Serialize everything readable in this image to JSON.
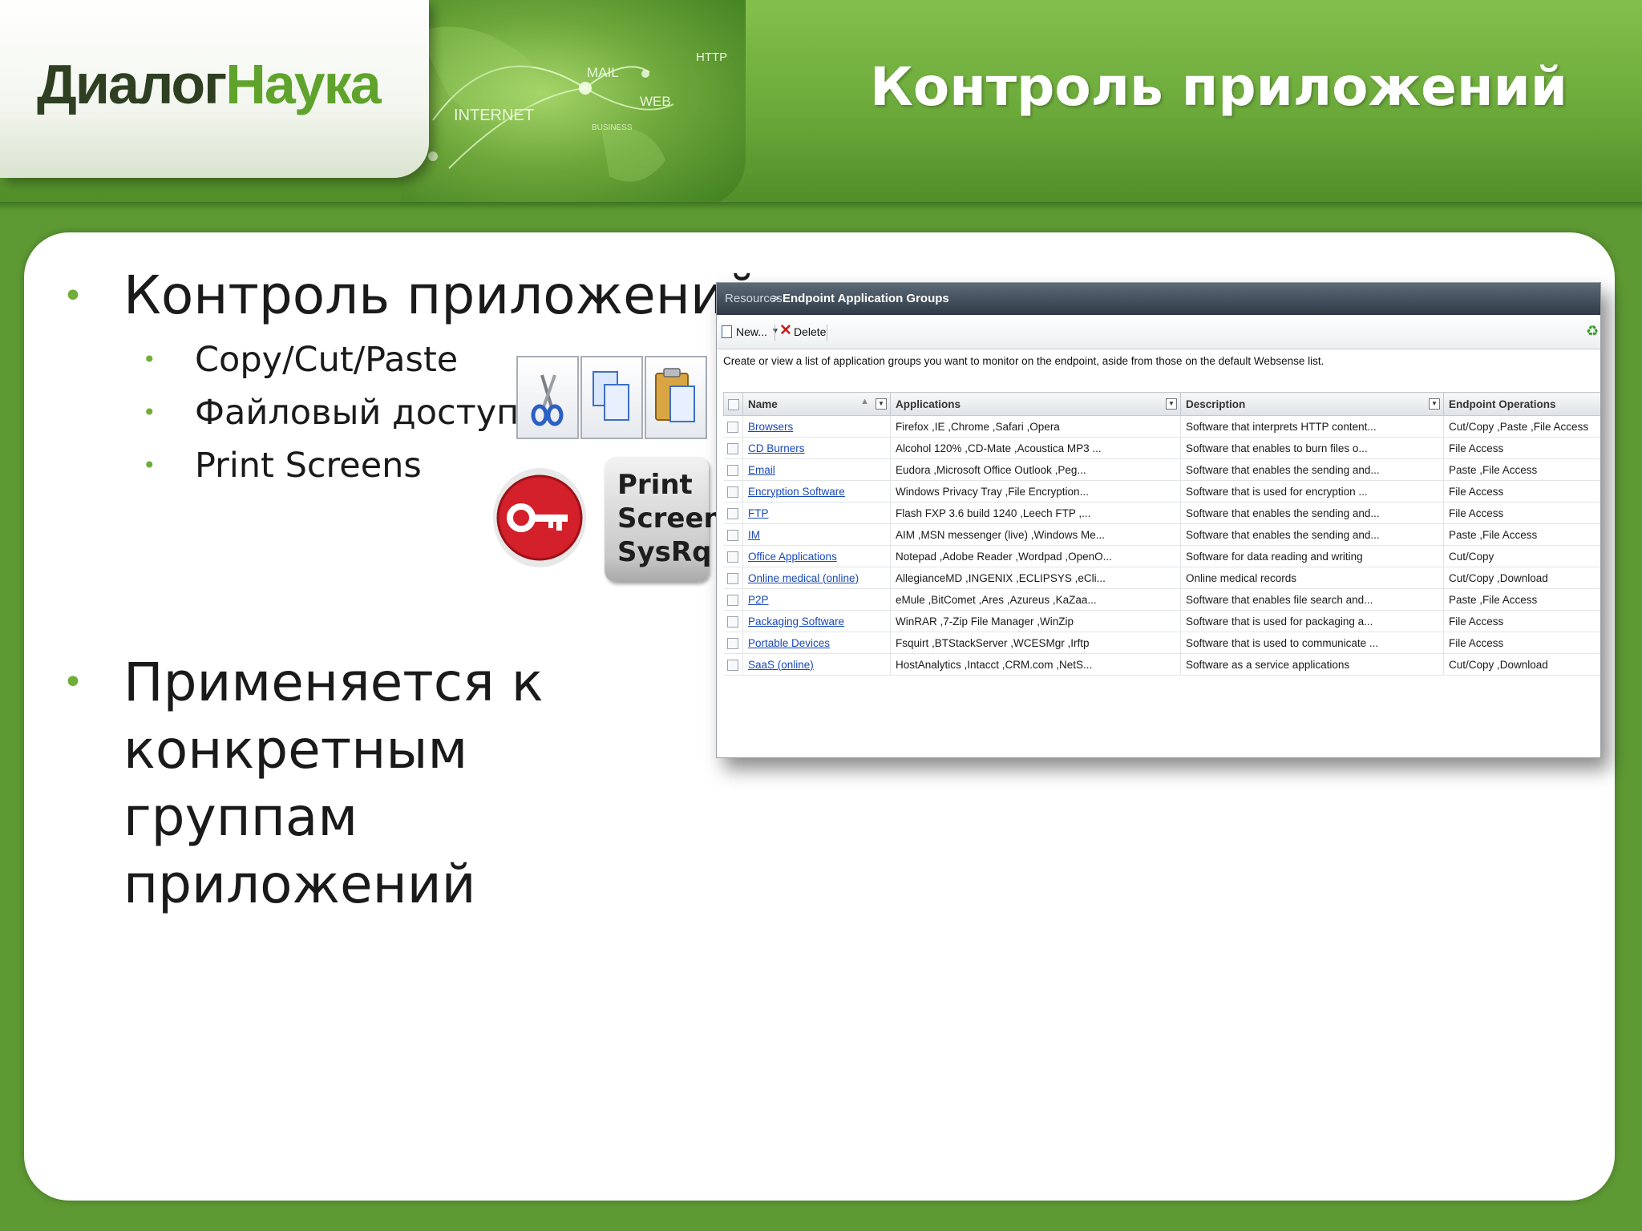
{
  "header": {
    "logo_part1": "Диалог",
    "logo_part2": "Наука",
    "title": "Контроль приложений",
    "globe_labels": [
      "HTTP",
      "MAIL",
      "WEB",
      "INTERNET",
      "BUSINESS"
    ]
  },
  "bullets": {
    "main1": "Контроль приложений:",
    "sub": [
      "Copy/Cut/Paste",
      "Файловый доступ",
      "Print Screens"
    ],
    "main2": "Применяется к конкретным группам приложений"
  },
  "icons": [
    "scissors-icon",
    "copy-icon",
    "paste-icon",
    "key-icon",
    "print-screen-key"
  ],
  "printscreen_key": [
    "Print",
    "Screen",
    "SysRq"
  ],
  "screenshot": {
    "breadcrumb_root": "Resources",
    "breadcrumb_sep": ">",
    "breadcrumb_current": "Endpoint Application Groups",
    "toolbar": {
      "new_label": "New...",
      "delete_label": "Delete"
    },
    "description": "Create or view a list of application groups you want to monitor on the endpoint, aside from those on the default Websense list.",
    "columns": [
      "Name",
      "Applications",
      "Description",
      "Endpoint Operations"
    ],
    "rows": [
      {
        "name": "Browsers",
        "apps": "Firefox ,IE ,Chrome ,Safari ,Opera",
        "desc": "Software that interprets HTTP content...",
        "ops": "Cut/Copy ,Paste ,File Access"
      },
      {
        "name": "CD Burners",
        "apps": "Alcohol 120% ,CD-Mate ,Acoustica MP3 ...",
        "desc": "Software that enables to burn files o...",
        "ops": "File Access"
      },
      {
        "name": "Email",
        "apps": "Eudora ,Microsoft Office Outlook ,Peg...",
        "desc": "Software that enables the sending and...",
        "ops": "Paste ,File Access"
      },
      {
        "name": "Encryption Software",
        "apps": "Windows Privacy Tray ,File Encryption...",
        "desc": "Software that is used for encryption ...",
        "ops": "File Access"
      },
      {
        "name": "FTP",
        "apps": "Flash FXP 3.6 build 1240 ,Leech FTP ,...",
        "desc": "Software that enables the sending and...",
        "ops": "File Access"
      },
      {
        "name": "IM",
        "apps": "AIM ,MSN messenger (live) ,Windows Me...",
        "desc": "Software that enables the sending and...",
        "ops": "Paste ,File Access"
      },
      {
        "name": "Office Applications",
        "apps": "Notepad ,Adobe Reader ,Wordpad ,OpenO...",
        "desc": "Software for data reading and writing",
        "ops": "Cut/Copy"
      },
      {
        "name": "Online medical (online)",
        "apps": "AllegianceMD ,INGENIX ,ECLIPSYS ,eCli...",
        "desc": "Online medical records",
        "ops": "Cut/Copy ,Download"
      },
      {
        "name": "P2P",
        "apps": "eMule ,BitComet ,Ares ,Azureus ,KaZaa...",
        "desc": "Software that enables file search and...",
        "ops": "Paste ,File Access"
      },
      {
        "name": "Packaging Software",
        "apps": "WinRAR ,7-Zip File Manager ,WinZip",
        "desc": "Software that is used for packaging a...",
        "ops": "File Access"
      },
      {
        "name": "Portable Devices",
        "apps": "Fsquirt ,BTStackServer ,WCESMgr ,Irftp",
        "desc": "Software that is used to communicate ...",
        "ops": "File Access"
      },
      {
        "name": "SaaS (online)",
        "apps": "HostAnalytics ,Intacct ,CRM.com ,NetS...",
        "desc": "Software as a service applications",
        "ops": "Cut/Copy ,Download"
      }
    ]
  },
  "colors": {
    "green": "#6aa83a",
    "dark_green": "#3d7420",
    "link": "#1848b8"
  }
}
